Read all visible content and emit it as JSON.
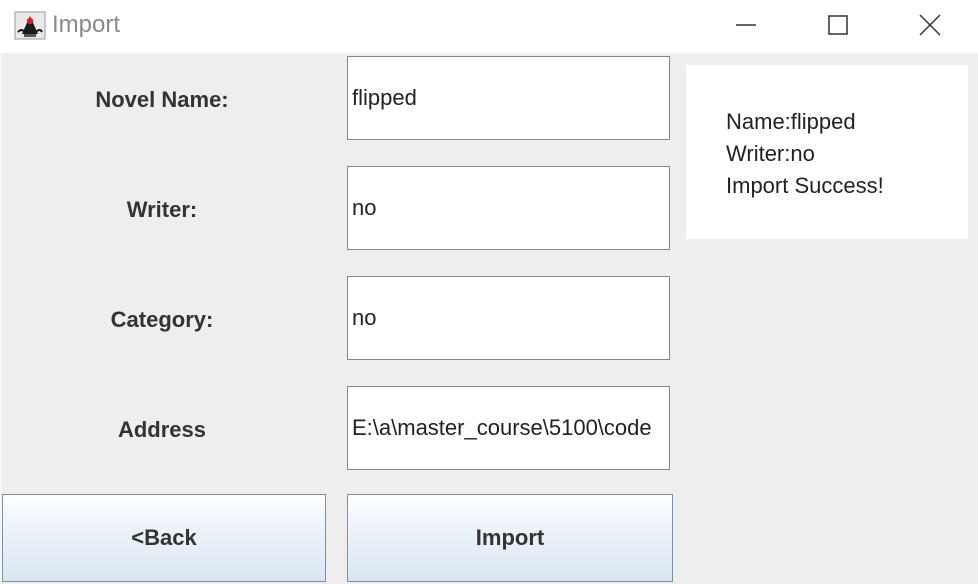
{
  "window": {
    "title": "Import",
    "app_icon": "java-duke-icon",
    "controls": {
      "minimize_icon": "minimize-icon",
      "maximize_icon": "maximize-icon",
      "close_icon": "close-icon"
    }
  },
  "form": {
    "novel_name": {
      "label": "Novel Name:",
      "value": "flipped"
    },
    "writer": {
      "label": "Writer:",
      "value": "no"
    },
    "category": {
      "label": "Category:",
      "value": "no"
    },
    "address": {
      "label": "Address",
      "value": "E:\\a\\master_course\\5100\\code"
    }
  },
  "output": {
    "lines": [
      "Name:flipped",
      "Writer:no",
      "Import Success!"
    ]
  },
  "buttons": {
    "back_label": "<Back",
    "import_label": "Import"
  },
  "colors": {
    "background": "#eeeeee",
    "field_border": "#7a8a99",
    "button_gradient_top": "#ffffff",
    "button_gradient_bottom": "#d9e6f2"
  }
}
